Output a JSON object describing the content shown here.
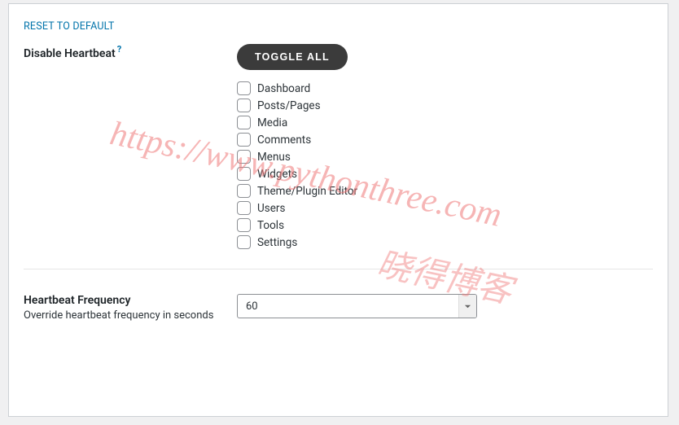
{
  "reset_label": "RESET TO DEFAULT",
  "disable_heartbeat": {
    "title": "Disable Heartbeat",
    "help": "?",
    "toggle_all_label": "TOGGLE ALL",
    "options": [
      {
        "label": "Dashboard",
        "checked": false
      },
      {
        "label": "Posts/Pages",
        "checked": false
      },
      {
        "label": "Media",
        "checked": false
      },
      {
        "label": "Comments",
        "checked": false
      },
      {
        "label": "Menus",
        "checked": false
      },
      {
        "label": "Widgets",
        "checked": false
      },
      {
        "label": "Theme/Plugin Editor",
        "checked": false
      },
      {
        "label": "Users",
        "checked": false
      },
      {
        "label": "Tools",
        "checked": false
      },
      {
        "label": "Settings",
        "checked": false
      }
    ]
  },
  "heartbeat_frequency": {
    "title": "Heartbeat Frequency",
    "description": "Override heartbeat frequency in seconds",
    "value": "60"
  },
  "watermarks": {
    "url": "https://www.pythonthree.com",
    "cn": "晓得博客"
  }
}
